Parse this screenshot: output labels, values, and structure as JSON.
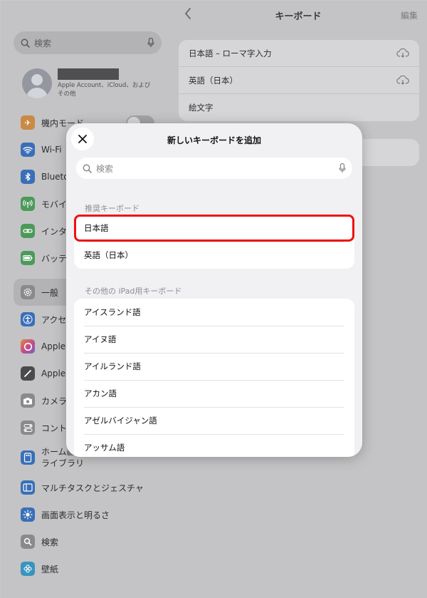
{
  "sidebar": {
    "search_placeholder": "検索",
    "profile_subtitle": "Apple Account、iCloud、および その他",
    "items": [
      {
        "label": "機内モード",
        "icon": "airplane-icon",
        "color": "#f0922e"
      },
      {
        "label": "Wi-Fi",
        "icon": "wifi-icon",
        "color": "#3478f6"
      },
      {
        "label": "Blueto",
        "icon": "bluetooth-icon",
        "color": "#3478f6"
      },
      {
        "label": "モバイ",
        "icon": "cellular-icon",
        "color": "#34c759"
      },
      {
        "label": "インター",
        "icon": "hotspot-icon",
        "color": "#34c759"
      },
      {
        "label": "バッテ",
        "icon": "battery-icon",
        "color": "#34c759"
      },
      {
        "label": "一般",
        "icon": "gear-icon",
        "color": "#8e8e93"
      },
      {
        "label": "アクセシ",
        "icon": "accessibility-icon",
        "color": "#3478f6"
      },
      {
        "label": "Apple I",
        "icon": "apple-intelligence-icon",
        "color": "#d65b9c"
      },
      {
        "label": "Apple I",
        "icon": "pencil-icon",
        "color": "#48484a"
      },
      {
        "label": "カメラ",
        "icon": "camera-icon",
        "color": "#8e8e93"
      },
      {
        "label": "コントロ",
        "icon": "control-center-icon",
        "color": "#8e8e93"
      },
      {
        "label": "ホーム画\nライブラリ",
        "icon": "home-screen-icon",
        "color": "#3478f6"
      },
      {
        "label": "マルチタスクとジェスチャ",
        "icon": "multitasking-icon",
        "color": "#3478f6"
      },
      {
        "label": "画面表示と明るさ",
        "icon": "brightness-icon",
        "color": "#3478f6"
      },
      {
        "label": "検索",
        "icon": "search-icon",
        "color": "#8e8e93"
      },
      {
        "label": "壁紙",
        "icon": "wallpaper-icon",
        "color": "#35aadc"
      }
    ]
  },
  "main": {
    "title": "キーボード",
    "edit_label": "編集",
    "keyboards": [
      {
        "label": "日本語 – ローマ字入力",
        "icon": "cloud-download-icon"
      },
      {
        "label": "英語（日本）",
        "icon": "cloud-download-icon"
      },
      {
        "label": "絵文字",
        "icon": ""
      }
    ]
  },
  "modal": {
    "title": "新しいキーボードを追加",
    "search_placeholder": "検索",
    "recommended_header": "推奨キーボード",
    "recommended": [
      "日本語",
      "英語（日本）"
    ],
    "other_header": "その他の iPad用キーボード",
    "others": [
      "アイスランド語",
      "アイヌ語",
      "アイルランド語",
      "アカン語",
      "アゼルバイジャン語",
      "アッサム語"
    ]
  },
  "colors": {
    "highlight": "#ee1111"
  }
}
